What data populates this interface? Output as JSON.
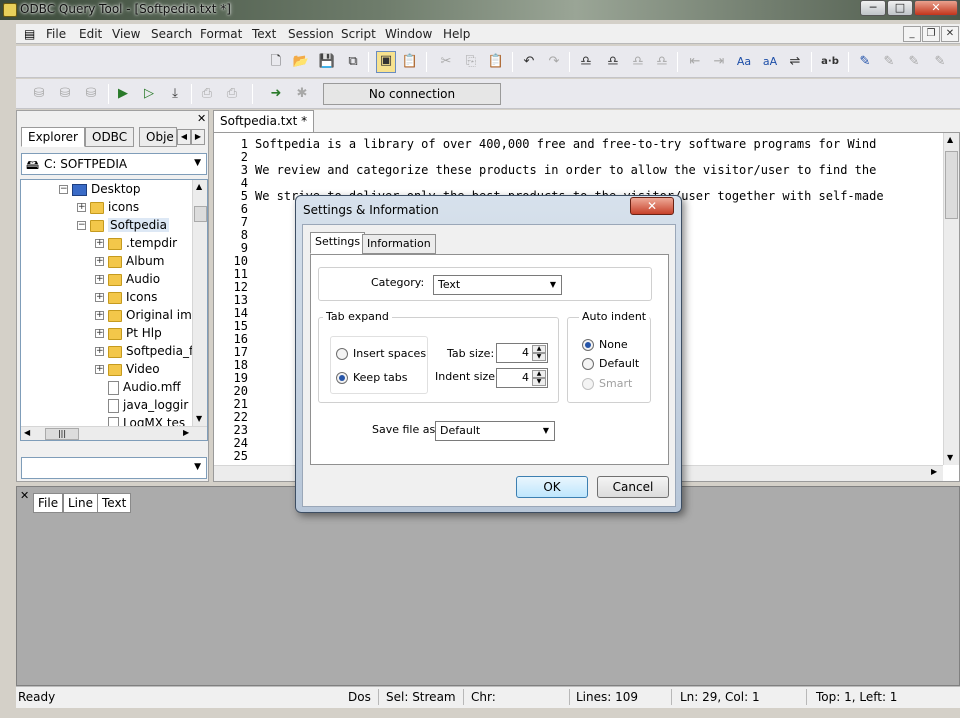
{
  "window": {
    "title": "ODBC Query Tool - [Softpedia.txt *]",
    "minimize": "─",
    "maximize": "□",
    "close": "✕"
  },
  "menu": [
    "File",
    "Edit",
    "View",
    "Search",
    "Format",
    "Text",
    "Session",
    "Script",
    "Window",
    "Help"
  ],
  "mdi_controls": {
    "minimize": "_",
    "restore": "❐",
    "close": "✕"
  },
  "connection": {
    "status": "No connection"
  },
  "explorer": {
    "tabs": [
      "Explorer",
      "ODBC",
      "Obje"
    ],
    "drive": "C:  SOFTPEDIA",
    "tree": [
      {
        "label": "Desktop",
        "type": "desktop",
        "expander": "-"
      },
      {
        "label": "icons",
        "type": "folder",
        "expander": "+"
      },
      {
        "label": "Softpedia",
        "type": "folder",
        "expander": "-"
      },
      {
        "label": ".tempdir",
        "type": "folder",
        "expander": "+"
      },
      {
        "label": "Album",
        "type": "folder",
        "expander": "+"
      },
      {
        "label": "Audio",
        "type": "folder",
        "expander": "+"
      },
      {
        "label": "Icons",
        "type": "folder",
        "expander": "+"
      },
      {
        "label": "Original im",
        "type": "folder",
        "expander": "+"
      },
      {
        "label": "Pt Hlp",
        "type": "folder",
        "expander": "+"
      },
      {
        "label": "Softpedia_f",
        "type": "folder",
        "expander": "+"
      },
      {
        "label": "Video",
        "type": "folder",
        "expander": "+"
      },
      {
        "label": "Audio.mff",
        "type": "file",
        "expander": ""
      },
      {
        "label": "java_loggir",
        "type": "file",
        "expander": ""
      },
      {
        "label": "LogMX tes",
        "type": "file",
        "expander": ""
      }
    ]
  },
  "editor": {
    "tab": "Softpedia.txt *",
    "line_numbers": [
      "1",
      "2",
      "3",
      "4",
      "5",
      "6",
      "7",
      "8",
      "9",
      "10",
      "11",
      "12",
      "13",
      "14",
      "15",
      "16",
      "17",
      "18",
      "19",
      "20",
      "21",
      "22",
      "23",
      "24",
      "25"
    ],
    "lines": [
      "Softpedia is a library of over 400,000 free and free-to-try software programs for Wind",
      "",
      "We review and categorize these products in order to allow the visitor/user to find the",
      "",
      "We strive to deliver only the best products to the visitor/user together with self-made"
    ]
  },
  "bottom_tabs": [
    "File",
    "Line",
    "Text"
  ],
  "status": {
    "ready": "Ready",
    "format": "Dos",
    "selection": "Sel: Stream",
    "chr": "Chr:",
    "lines": "Lines: 109",
    "position": "Ln: 29, Col: 1",
    "top_left": "Top: 1, Left: 1"
  },
  "dialog": {
    "title": "Settings & Information",
    "close": "✕",
    "tabs": [
      "Settings",
      "Information"
    ],
    "category_label": "Category:",
    "category_value": "Text",
    "tab_expand": {
      "title": "Tab expand",
      "options": [
        "Insert spaces",
        "Keep tabs"
      ],
      "selected": "Keep tabs",
      "tab_size_label": "Tab size:",
      "tab_size": "4",
      "indent_size_label": "Indent size:",
      "indent_size": "4"
    },
    "auto_indent": {
      "title": "Auto indent",
      "options": [
        "None",
        "Default",
        "Smart"
      ],
      "selected": "None",
      "disabled": "Smart"
    },
    "save_label": "Save file as:",
    "save_value": "Default",
    "ok": "OK",
    "cancel": "Cancel"
  }
}
